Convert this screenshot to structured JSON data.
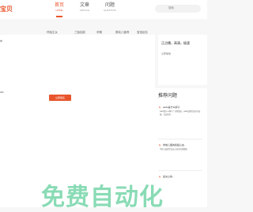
{
  "header": {
    "logo": "宝贝",
    "nav": [
      {
        "label": "首页",
        "sub": "HOME",
        "active": true
      },
      {
        "label": "文章",
        "sub": "ARTICLE",
        "active": false
      },
      {
        "label": "问题",
        "sub": "QUESTION",
        "active": false
      }
    ],
    "search_placeholder": "搜索"
  },
  "categories": [
    "怀胎生女",
    "三胎抽奖",
    "孕期",
    "婴幼儿营养",
    "宝宝起名"
  ],
  "side_card": {
    "title": "正点播，高清，极速",
    "subtitle": "立即播放"
  },
  "main": {
    "fragment_top": "中",
    "fragment_mid": "OR",
    "button_label": "立即报名"
  },
  "recommend": {
    "title": "推荐问题",
    "items": [
      {
        "q": "pads是什么牌子",
        "a": "pads是什么牌子？在我看来，pads品牌定位较为高端，且品质也..."
      },
      {
        "q": "学前儿童的积极心态..",
        "a": "学前儿童要学会自己适当控制情绪..."
      },
      {
        "q": "最关心的...",
        "a": ""
      }
    ]
  },
  "watermark": "免费自动化"
}
